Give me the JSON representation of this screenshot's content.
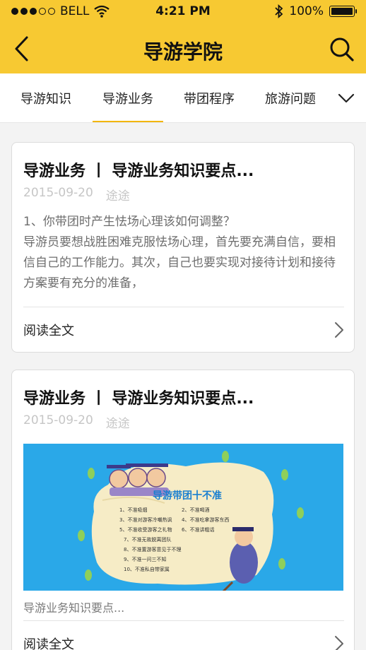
{
  "status_bar": {
    "carrier": "BELL",
    "time": "4:21 PM",
    "battery": "100%",
    "battery_level": 1.0,
    "signal_bars": 3,
    "signal_max": 5
  },
  "nav": {
    "title": "导游学院",
    "back_icon": "chevron-left-icon",
    "search_icon": "search-icon"
  },
  "tabs": {
    "items": [
      "导游知识",
      "导游业务",
      "带团程序",
      "旅游问题"
    ],
    "active_index": 1,
    "more_icon": "chevron-down-icon",
    "accent_color": "#f2b600"
  },
  "articles": [
    {
      "title": "导游业务 丨 导游业务知识要点...",
      "date": "2015-09-20",
      "author": "途途",
      "excerpt": "1、你带团时产生怯场心理该如何调整？\n导游员要想战胜困难克服怯场心理，首先要充满自信，要相信自己的工作能力。其次，自己也要实现对接待计划和接待方案要有充分的准备，",
      "read_more": "阅读全文"
    },
    {
      "title": "导游业务 丨 导游业务知识要点...",
      "date": "2015-09-20",
      "author": "途途",
      "caption": "导游业务知识要点...",
      "read_more": "阅读全文",
      "image": {
        "heading": "导游带团十不准",
        "rules": [
          "1、不准吸烟",
          "2、不准喝酒",
          "3、不准对游客冷嘲热讽",
          "4、不准吃拿游客东西",
          "5、不准收受游客之礼物",
          "6、不准讲粗话",
          "7、不准无故脱离团队",
          "8、不准置游客意见于不理",
          "9、不准一问三不知",
          "10、不准私自带家属"
        ]
      }
    }
  ],
  "colors": {
    "header_yellow": "#f7c932",
    "page_bg": "#f3f3f3",
    "image_blue": "#2aa8e8"
  }
}
